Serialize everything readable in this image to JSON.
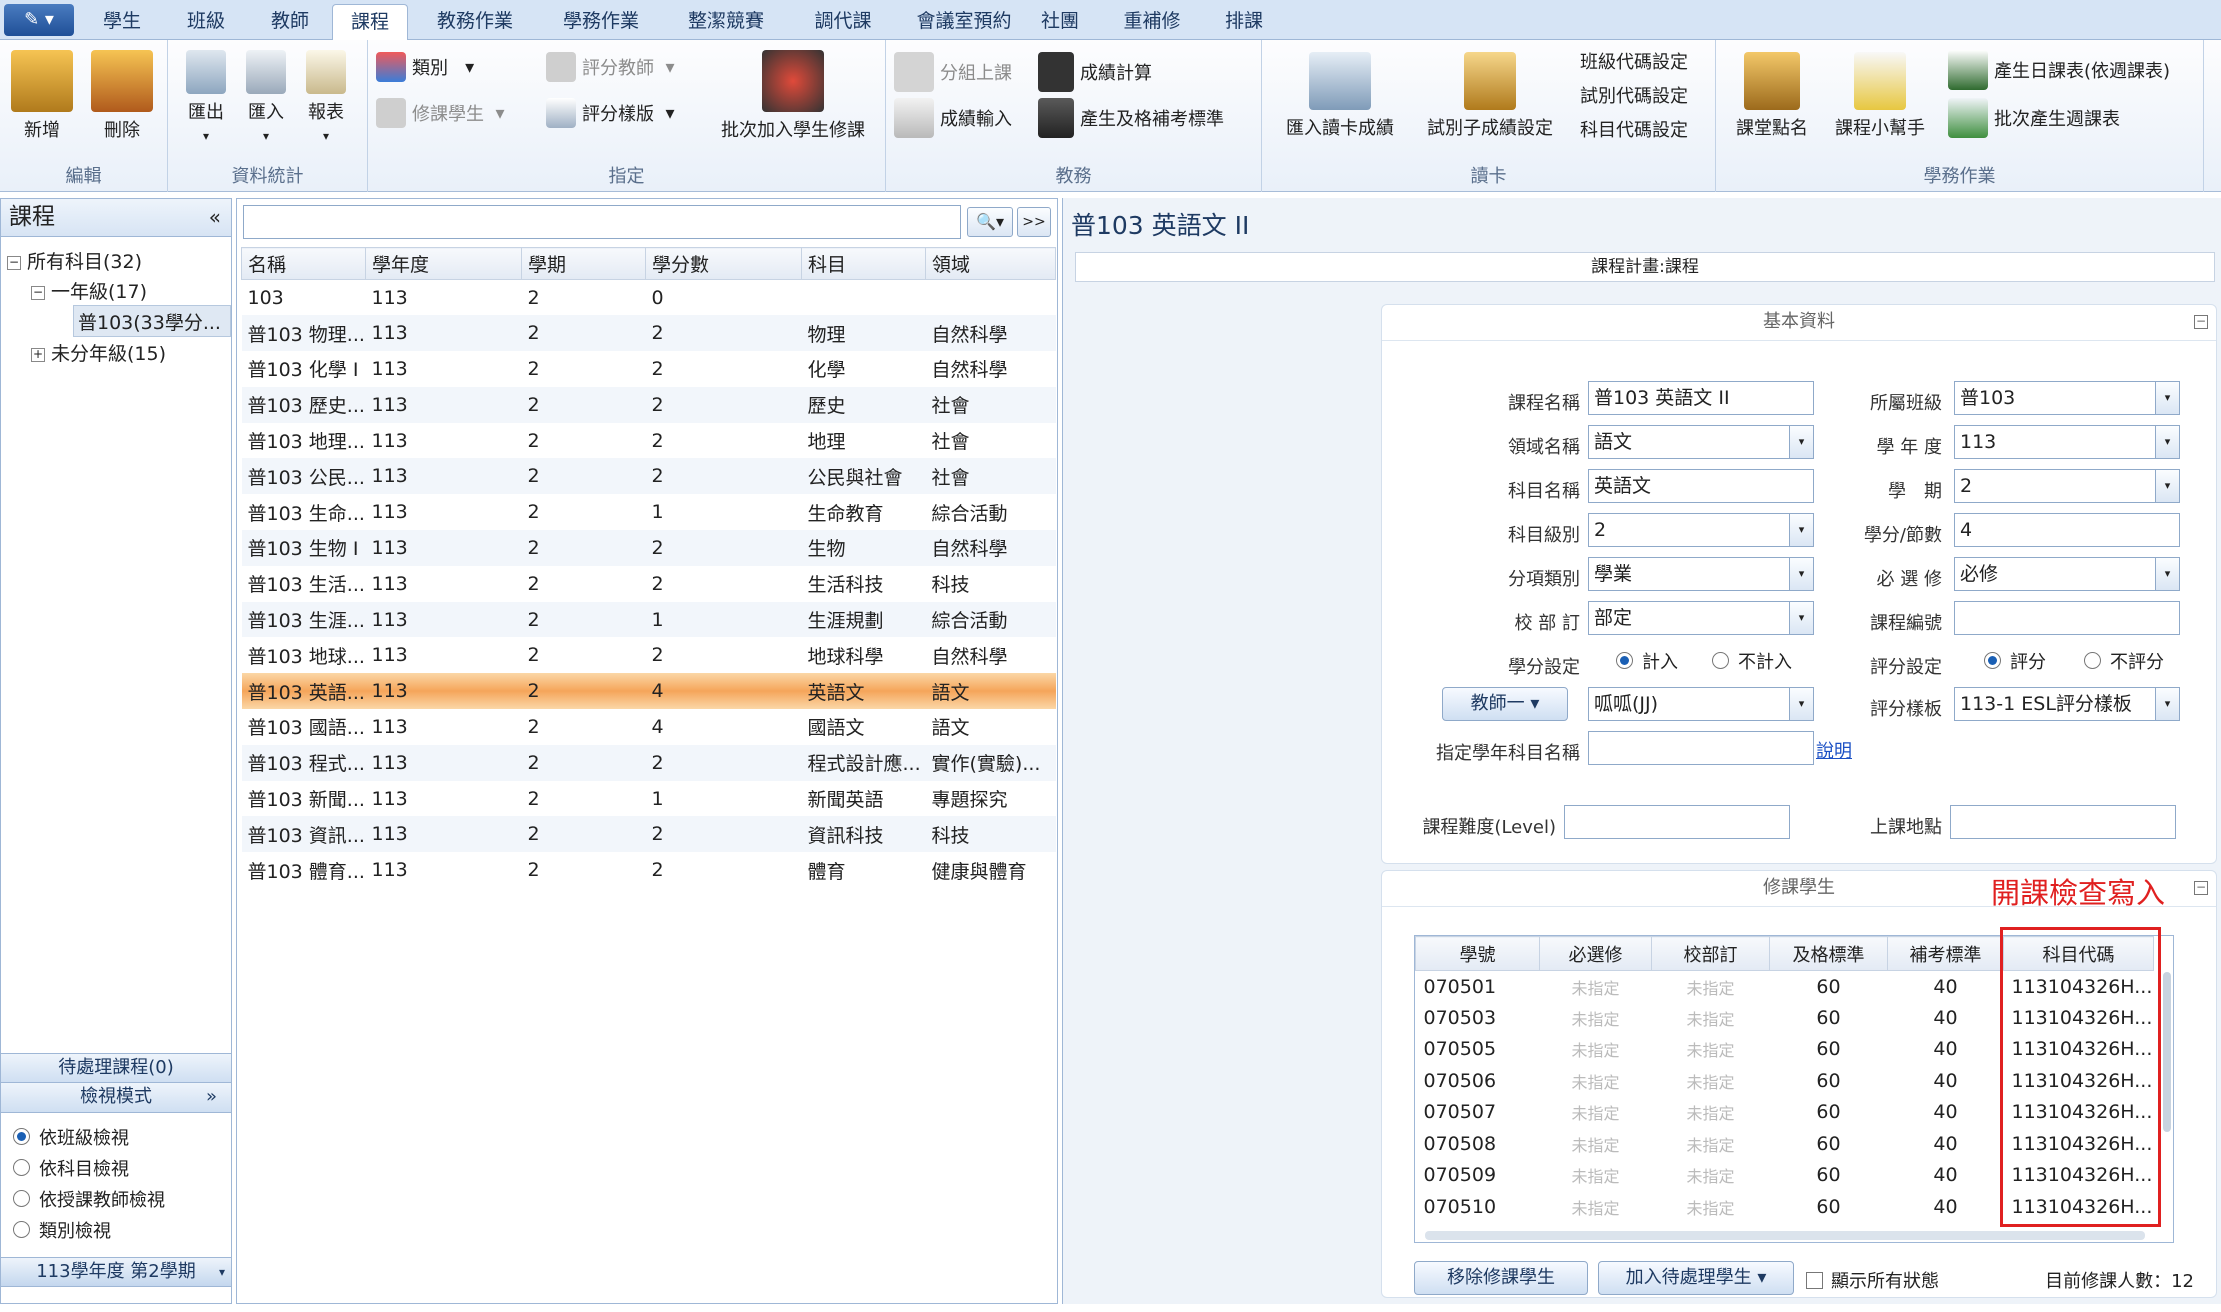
{
  "tabs": [
    "學生",
    "班級",
    "教師",
    "課程",
    "教務作業",
    "學務作業",
    "整潔競賽",
    "調代課",
    "會議室預約",
    "社團",
    "重補修",
    "排課"
  ],
  "active_tab": "課程",
  "ribbon": {
    "edit": {
      "label": "編輯",
      "add": "新增",
      "delete": "刪除"
    },
    "stats": {
      "label": "資料統計",
      "export": "匯出",
      "import": "匯入",
      "report": "報表"
    },
    "assign": {
      "label": "指定",
      "category": "類別",
      "course_students": "修課學生",
      "grading_teacher": "評分教師",
      "grading_template": "評分樣版",
      "batch_add": "批次加入學生修課"
    },
    "academic": {
      "label": "教務",
      "group_class": "分組上課",
      "score_input": "成績輸入",
      "score_calc": "成績計算",
      "pass_makeup": "產生及格補考標準"
    },
    "card": {
      "label": "讀卡",
      "import_card": "匯入讀卡成績",
      "exam_code_gen": "試別子成績設定",
      "class_code": "班級代碼設定",
      "exam_code": "試別代碼設定",
      "subject_code": "科目代碼設定"
    },
    "student_affairs": {
      "label": "學務作業",
      "roll_call": "課堂點名",
      "helper": "課程小幫手",
      "daily_schedule": "產生日課表(依週課表)",
      "batch_weekly": "批次產生週課表"
    }
  },
  "left": {
    "title": "課程",
    "tree": {
      "all": "所有科目(32)",
      "grade1": "一年級(17)",
      "class": "普103(33學分...",
      "ungraded": "未分年級(15)"
    },
    "pending": "待處理課程(0)",
    "view_mode": "檢視模式",
    "radios": [
      "依班級檢視",
      "依科目檢視",
      "依授課教師檢視",
      "類別檢視"
    ],
    "semester": "113學年度 第2學期"
  },
  "courses": {
    "headers": [
      "名稱",
      "學年度",
      "學期",
      "學分數",
      "科目",
      "領域"
    ],
    "rows": [
      [
        "103",
        "113",
        "2",
        "0",
        "",
        ""
      ],
      [
        "普103 物理...",
        "113",
        "2",
        "2",
        "物理",
        "自然科學"
      ],
      [
        "普103 化學 I",
        "113",
        "2",
        "2",
        "化學",
        "自然科學"
      ],
      [
        "普103 歷史...",
        "113",
        "2",
        "2",
        "歷史",
        "社會"
      ],
      [
        "普103 地理...",
        "113",
        "2",
        "2",
        "地理",
        "社會"
      ],
      [
        "普103 公民...",
        "113",
        "2",
        "2",
        "公民與社會",
        "社會"
      ],
      [
        "普103 生命...",
        "113",
        "2",
        "1",
        "生命教育",
        "綜合活動"
      ],
      [
        "普103 生物 I",
        "113",
        "2",
        "2",
        "生物",
        "自然科學"
      ],
      [
        "普103 生活...",
        "113",
        "2",
        "2",
        "生活科技",
        "科技"
      ],
      [
        "普103 生涯...",
        "113",
        "2",
        "1",
        "生涯規劃",
        "綜合活動"
      ],
      [
        "普103 地球...",
        "113",
        "2",
        "2",
        "地球科學",
        "自然科學"
      ],
      [
        "普103 英語...",
        "113",
        "2",
        "4",
        "英語文",
        "語文"
      ],
      [
        "普103 國語...",
        "113",
        "2",
        "4",
        "國語文",
        "語文"
      ],
      [
        "普103 程式...",
        "113",
        "2",
        "2",
        "程式設計應...",
        "實作(實驗)..."
      ],
      [
        "普103 新聞...",
        "113",
        "2",
        "1",
        "新聞英語",
        "專題探究"
      ],
      [
        "普103 資訊...",
        "113",
        "2",
        "2",
        "資訊科技",
        "科技"
      ],
      [
        "普103 體育...",
        "113",
        "2",
        "2",
        "體育",
        "健康與體育"
      ]
    ],
    "selected_index": 11
  },
  "detail": {
    "title": "普103  英語文 II",
    "subtitle": "課程計畫:課程",
    "basic_header": "基本資料",
    "labels": {
      "course_name": "課程名稱",
      "domain": "領域名稱",
      "subject": "科目名稱",
      "level": "科目級別",
      "category": "分項類別",
      "required_by": "校 部 訂",
      "credit_setting": "學分設定",
      "class": "所屬班級",
      "year": "學 年 度",
      "semester": "學　期",
      "credit": "學分/節數",
      "elective": "必 選 修",
      "course_no": "課程編號",
      "grade_setting": "評分設定",
      "grade_template": "評分樣板",
      "assign_name": "指定學年科目名稱",
      "difficulty": "課程難度(Level)",
      "location": "上課地點"
    },
    "values": {
      "course_name": "普103 英語文 II",
      "domain": "語文",
      "subject": "英語文",
      "level": "2",
      "category": "學業",
      "required_by": "部定",
      "class": "普103",
      "year": "113",
      "semester": "2",
      "credit": "4",
      "elective": "必修",
      "course_no": "",
      "teacher": "呱呱(JJ)",
      "grade_template": "113-1 ESL評分樣板",
      "assign_name": "",
      "difficulty": "",
      "location": ""
    },
    "teacher_btn": "教師一",
    "credit_opts": [
      "計入",
      "不計入"
    ],
    "grade_opts": [
      "評分",
      "不評分"
    ],
    "explain_link": "說明"
  },
  "students": {
    "header": "修課學生",
    "annotation": "開課檢查寫入",
    "headers": [
      "學號",
      "必選修",
      "校部訂",
      "及格標準",
      "補考標準",
      "科目代碼"
    ],
    "unspecified": "未指定",
    "rows": [
      [
        "070501",
        "60",
        "40",
        "113104326H..."
      ],
      [
        "070503",
        "60",
        "40",
        "113104326H..."
      ],
      [
        "070505",
        "60",
        "40",
        "113104326H..."
      ],
      [
        "070506",
        "60",
        "40",
        "113104326H..."
      ],
      [
        "070507",
        "60",
        "40",
        "113104326H..."
      ],
      [
        "070508",
        "60",
        "40",
        "113104326H..."
      ],
      [
        "070509",
        "60",
        "40",
        "113104326H..."
      ],
      [
        "070510",
        "60",
        "40",
        "113104326H..."
      ]
    ],
    "remove_btn": "移除修課學生",
    "add_pending_btn": "加入待處理學生",
    "show_all": "顯示所有狀態",
    "count_text": "目前修課人數：12"
  },
  "colors": {
    "accent": "#1e3a62",
    "selected_row": "#f5a55a",
    "annotation": "#e02020"
  }
}
